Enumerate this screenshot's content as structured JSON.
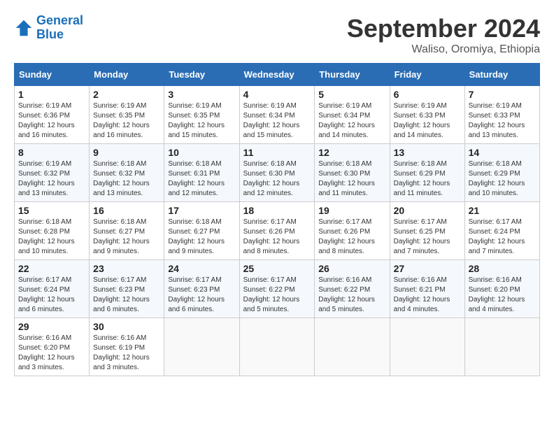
{
  "header": {
    "logo_line1": "General",
    "logo_line2": "Blue",
    "month": "September 2024",
    "location": "Waliso, Oromiya, Ethiopia"
  },
  "columns": [
    "Sunday",
    "Monday",
    "Tuesday",
    "Wednesday",
    "Thursday",
    "Friday",
    "Saturday"
  ],
  "weeks": [
    [
      {
        "day": "1",
        "sunrise": "6:19 AM",
        "sunset": "6:36 PM",
        "daylight": "12 hours and 16 minutes."
      },
      {
        "day": "2",
        "sunrise": "6:19 AM",
        "sunset": "6:35 PM",
        "daylight": "12 hours and 16 minutes."
      },
      {
        "day": "3",
        "sunrise": "6:19 AM",
        "sunset": "6:35 PM",
        "daylight": "12 hours and 15 minutes."
      },
      {
        "day": "4",
        "sunrise": "6:19 AM",
        "sunset": "6:34 PM",
        "daylight": "12 hours and 15 minutes."
      },
      {
        "day": "5",
        "sunrise": "6:19 AM",
        "sunset": "6:34 PM",
        "daylight": "12 hours and 14 minutes."
      },
      {
        "day": "6",
        "sunrise": "6:19 AM",
        "sunset": "6:33 PM",
        "daylight": "12 hours and 14 minutes."
      },
      {
        "day": "7",
        "sunrise": "6:19 AM",
        "sunset": "6:33 PM",
        "daylight": "12 hours and 13 minutes."
      }
    ],
    [
      {
        "day": "8",
        "sunrise": "6:19 AM",
        "sunset": "6:32 PM",
        "daylight": "12 hours and 13 minutes."
      },
      {
        "day": "9",
        "sunrise": "6:18 AM",
        "sunset": "6:32 PM",
        "daylight": "12 hours and 13 minutes."
      },
      {
        "day": "10",
        "sunrise": "6:18 AM",
        "sunset": "6:31 PM",
        "daylight": "12 hours and 12 minutes."
      },
      {
        "day": "11",
        "sunrise": "6:18 AM",
        "sunset": "6:30 PM",
        "daylight": "12 hours and 12 minutes."
      },
      {
        "day": "12",
        "sunrise": "6:18 AM",
        "sunset": "6:30 PM",
        "daylight": "12 hours and 11 minutes."
      },
      {
        "day": "13",
        "sunrise": "6:18 AM",
        "sunset": "6:29 PM",
        "daylight": "12 hours and 11 minutes."
      },
      {
        "day": "14",
        "sunrise": "6:18 AM",
        "sunset": "6:29 PM",
        "daylight": "12 hours and 10 minutes."
      }
    ],
    [
      {
        "day": "15",
        "sunrise": "6:18 AM",
        "sunset": "6:28 PM",
        "daylight": "12 hours and 10 minutes."
      },
      {
        "day": "16",
        "sunrise": "6:18 AM",
        "sunset": "6:27 PM",
        "daylight": "12 hours and 9 minutes."
      },
      {
        "day": "17",
        "sunrise": "6:18 AM",
        "sunset": "6:27 PM",
        "daylight": "12 hours and 9 minutes."
      },
      {
        "day": "18",
        "sunrise": "6:17 AM",
        "sunset": "6:26 PM",
        "daylight": "12 hours and 8 minutes."
      },
      {
        "day": "19",
        "sunrise": "6:17 AM",
        "sunset": "6:26 PM",
        "daylight": "12 hours and 8 minutes."
      },
      {
        "day": "20",
        "sunrise": "6:17 AM",
        "sunset": "6:25 PM",
        "daylight": "12 hours and 7 minutes."
      },
      {
        "day": "21",
        "sunrise": "6:17 AM",
        "sunset": "6:24 PM",
        "daylight": "12 hours and 7 minutes."
      }
    ],
    [
      {
        "day": "22",
        "sunrise": "6:17 AM",
        "sunset": "6:24 PM",
        "daylight": "12 hours and 6 minutes."
      },
      {
        "day": "23",
        "sunrise": "6:17 AM",
        "sunset": "6:23 PM",
        "daylight": "12 hours and 6 minutes."
      },
      {
        "day": "24",
        "sunrise": "6:17 AM",
        "sunset": "6:23 PM",
        "daylight": "12 hours and 6 minutes."
      },
      {
        "day": "25",
        "sunrise": "6:17 AM",
        "sunset": "6:22 PM",
        "daylight": "12 hours and 5 minutes."
      },
      {
        "day": "26",
        "sunrise": "6:16 AM",
        "sunset": "6:22 PM",
        "daylight": "12 hours and 5 minutes."
      },
      {
        "day": "27",
        "sunrise": "6:16 AM",
        "sunset": "6:21 PM",
        "daylight": "12 hours and 4 minutes."
      },
      {
        "day": "28",
        "sunrise": "6:16 AM",
        "sunset": "6:20 PM",
        "daylight": "12 hours and 4 minutes."
      }
    ],
    [
      {
        "day": "29",
        "sunrise": "6:16 AM",
        "sunset": "6:20 PM",
        "daylight": "12 hours and 3 minutes."
      },
      {
        "day": "30",
        "sunrise": "6:16 AM",
        "sunset": "6:19 PM",
        "daylight": "12 hours and 3 minutes."
      },
      null,
      null,
      null,
      null,
      null
    ]
  ]
}
